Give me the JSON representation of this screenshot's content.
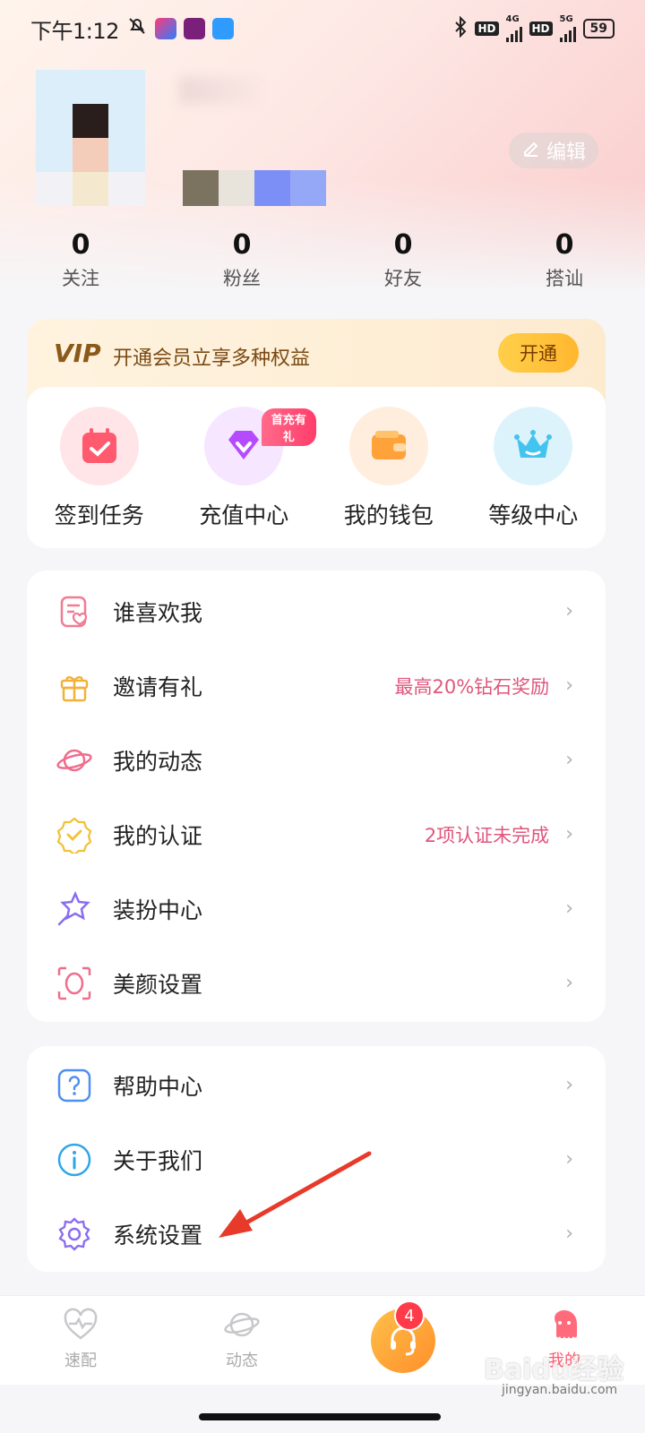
{
  "status_bar": {
    "time": "下午1:12",
    "network_4g": "4G",
    "network_5g": "5G",
    "hd": "HD",
    "battery": "59"
  },
  "profile": {
    "edit_label": "编辑",
    "avatar_colors": [
      "#dbeefa",
      "#dbeefa",
      "#dbeefa",
      "#dbeefa",
      "#2a1e1c",
      "#dbeefa",
      "#dbeefa",
      "#f3cdb9",
      "#dbeefa",
      "#f2f2f6",
      "#f4e8cf",
      "#f2f2f6"
    ],
    "swatch_colors": [
      "#7c7260",
      "#e8e4dc",
      "#7c8ff7",
      "#95a7f7"
    ]
  },
  "stats": [
    {
      "value": "0",
      "label": "关注"
    },
    {
      "value": "0",
      "label": "粉丝"
    },
    {
      "value": "0",
      "label": "好友"
    },
    {
      "value": "0",
      "label": "搭讪"
    }
  ],
  "vip": {
    "logo": "VIP",
    "text": "开通会员立享多种权益",
    "button": "开通"
  },
  "quick_actions": [
    {
      "label": "签到任务",
      "icon": "calendar-check-icon",
      "bg": "#ffe4e8"
    },
    {
      "label": "充值中心",
      "icon": "diamond-icon",
      "bg": "#f6e6ff",
      "badge": "首充有礼"
    },
    {
      "label": "我的钱包",
      "icon": "wallet-icon",
      "bg": "#ffeedd"
    },
    {
      "label": "等级中心",
      "icon": "crown-icon",
      "bg": "#ddf3fb"
    }
  ],
  "menu_group_1": [
    {
      "label": "谁喜欢我",
      "extra": "",
      "icon": "heart-note-icon"
    },
    {
      "label": "邀请有礼",
      "extra": "最高20%钻石奖励",
      "icon": "gift-icon"
    },
    {
      "label": "我的动态",
      "extra": "",
      "icon": "planet-icon"
    },
    {
      "label": "我的认证",
      "extra": "2项认证未完成",
      "icon": "verified-badge-icon"
    },
    {
      "label": "装扮中心",
      "extra": "",
      "icon": "magic-star-icon"
    },
    {
      "label": "美颜设置",
      "extra": "",
      "icon": "face-scan-icon"
    }
  ],
  "menu_group_2": [
    {
      "label": "帮助中心",
      "icon": "question-icon"
    },
    {
      "label": "关于我们",
      "icon": "info-icon"
    },
    {
      "label": "系统设置",
      "icon": "gear-icon"
    }
  ],
  "bottom_nav": [
    {
      "label": "速配",
      "icon": "heartbeat-icon"
    },
    {
      "label": "动态",
      "icon": "planet-outline-icon"
    },
    {
      "label": "",
      "icon": "headset-icon"
    },
    {
      "label": "我的",
      "icon": "mascot-icon"
    }
  ],
  "nav_badge": "4",
  "watermark": "Baidu经验",
  "watermark_sub": "jingyan.baidu.com",
  "colors": {
    "accent_pink": "#e0567d",
    "vip_gold": "#ffb72f",
    "badge_red": "#ff3b4a"
  }
}
